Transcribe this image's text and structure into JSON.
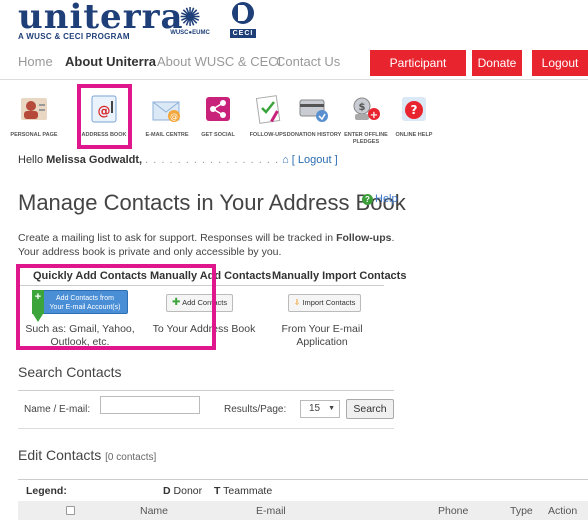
{
  "brand": {
    "uniterra": "uniterra",
    "uniterra_sub": "A WUSC & CECI PROGRAM",
    "wusc": "WUSC●EUMC",
    "ceci": "CECI"
  },
  "nav": {
    "items": [
      "Home",
      "About Uniterra",
      "About WUSC & CECI",
      "Contact Us"
    ],
    "active": "About Uniterra",
    "buttons": [
      "Participant Centre",
      "Donate",
      "Logout"
    ],
    "button_color": "#e8242f"
  },
  "tools": [
    {
      "label": "PERSONAL PAGE",
      "icon": "person-icon"
    },
    {
      "label": "ADDRESS BOOK",
      "icon": "address-book-icon"
    },
    {
      "label": "E-MAIL CENTRE",
      "icon": "email-icon"
    },
    {
      "label": "GET SOCIAL",
      "icon": "share-icon"
    },
    {
      "label": "FOLLOW-UPS",
      "icon": "checklist-icon"
    },
    {
      "label": "DONATION HISTORY",
      "icon": "card-icon"
    },
    {
      "label": "ENTER OFFLINE PLEDGES",
      "icon": "coins-add-icon"
    },
    {
      "label": "ONLINE HELP",
      "icon": "help-icon"
    }
  ],
  "hello": {
    "prefix": "Hello ",
    "name": "Melissa Godwaldt,",
    "dots": ". . . . . . . . . . . . . . . . .",
    "logout": "[ Logout ]"
  },
  "page": {
    "title": "Manage Contacts in Your Address Book",
    "help": "Help",
    "desc_1": "Create a mailing list to ask for support. Responses will be tracked in ",
    "desc_bold": "Follow-ups",
    "desc_2": ". Your address book is private and only accessible by you."
  },
  "options": {
    "quick": {
      "heading": "Quickly Add Contacts",
      "button_line1": "Add Contacts from",
      "button_line2": "Your E-mail Account(s)",
      "desc": "Such as: Gmail, Yahoo, Outlook, etc."
    },
    "manual": {
      "heading": "Manually Add Contacts",
      "button": "Add Contacts",
      "desc": "To Your Address Book"
    },
    "import": {
      "heading": "Manually Import Contacts",
      "button": "Import Contacts",
      "desc": "From Your E-mail Application"
    }
  },
  "search": {
    "title": "Search Contacts",
    "name_label": "Name / E-mail:",
    "name_value": "",
    "results_label": "Results/Page:",
    "results_value": "15",
    "button": "Search"
  },
  "edit": {
    "title": "Edit Contacts",
    "count": "[0 contacts]",
    "legend_label": "Legend:",
    "donor_key": "D",
    "donor": "Donor",
    "teammate_key": "T",
    "teammate": "Teammate",
    "columns": [
      "Name",
      "E-mail",
      "Phone",
      "Type",
      "Action"
    ]
  },
  "highlight_color": "#e0168c"
}
